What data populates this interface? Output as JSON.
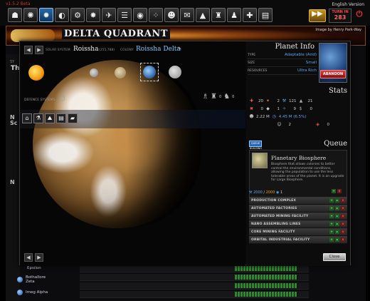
{
  "header": {
    "version_text": "v1.5.2 Beta",
    "english_version": "English Version",
    "turn_label": "TURN IN",
    "turn_value": "283",
    "toolbar_icons": [
      "home-icon",
      "galaxy-icon",
      "systems-icon",
      "fleet-icon",
      "build-icon",
      "explosion-icon",
      "ship-icon",
      "research-icon",
      "eye-icon",
      "scatter-icon",
      "contacts-icon",
      "mail-icon",
      "rank-icon",
      "trophy-icon",
      "profile-icon",
      "add-planet-icon",
      "book-icon"
    ]
  },
  "banner": {
    "title": "DELTA QUADRANT",
    "credit": "Image by Henry Park-Way"
  },
  "background": {
    "system_label": "SY",
    "system_letter": "Th",
    "left_letters": [
      "N",
      "Sc",
      "N"
    ],
    "systems": [
      {
        "name": "Epsilon"
      },
      {
        "name": "Bothallore Zeta"
      },
      {
        "name": "Imeg Alpha"
      }
    ]
  },
  "modal": {
    "solar_label": "SOLAR SYSTEM",
    "solar_name": "Roissha",
    "solar_coords": "(255,788)",
    "colony_label": "COLONY",
    "colony_name": "Roissha Delta",
    "colony_edit": "✎",
    "defence_label": "DEFENCE SYSTEMS",
    "ship_counts": [
      "0",
      "0"
    ],
    "planet_info": {
      "title": "Planet Info",
      "rows": [
        {
          "key": "TYPE",
          "value": "Adaptable (Arid)"
        },
        {
          "key": "SIZE",
          "value": "Small"
        },
        {
          "key": "RESOURCES",
          "value": "Ultra Rich"
        }
      ],
      "abandon_label": "ABANDON"
    },
    "stats": {
      "title": "Stats",
      "row1": [
        "20",
        "2",
        "121",
        "21"
      ],
      "row2": [
        "0",
        "1",
        "9",
        "0"
      ],
      "row3": [
        "2.22 M",
        "4.45 M (6.5%)"
      ],
      "row4": [
        "2",
        "0"
      ]
    },
    "queue": {
      "title": "Queue",
      "button_label": "QUEUE BUILDING",
      "current": {
        "title": "Planetary Biosphere",
        "description": "Biosphere that allows colonies to better control the environmental conditions, allowing the population to use the less tolerable areas of the planet. It is an upgrade for Large Biosphere.",
        "progress_a": "2000",
        "progress_b": "2000",
        "count": "1"
      },
      "items": [
        {
          "name": "PRODUCTION COMPLEX"
        },
        {
          "name": "AUTOMATED FACTORIES"
        },
        {
          "name": "AUTOMATED MINING FACILITY"
        },
        {
          "name": "NANO ASSEMBLING LINES"
        },
        {
          "name": "CORE MINING FACILITY"
        },
        {
          "name": "ORBITAL INDUSTRIAL FACILITY"
        }
      ]
    },
    "close_label": "Close"
  }
}
